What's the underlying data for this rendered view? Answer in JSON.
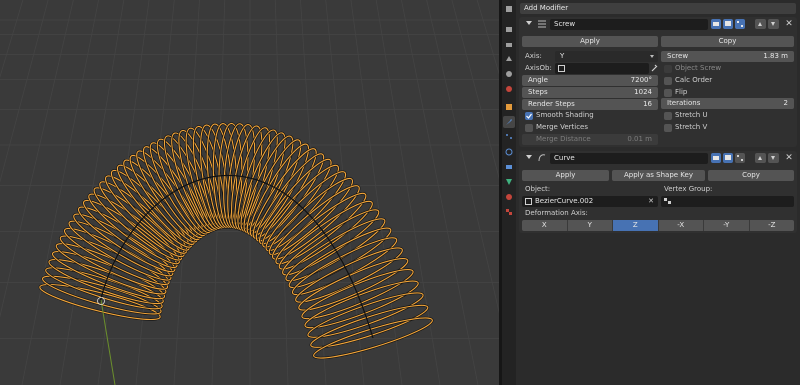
{
  "properties": {
    "add_modifier_label": "Add Modifier"
  },
  "screw": {
    "name": "Screw",
    "apply_label": "Apply",
    "copy_label": "Copy",
    "axis_label": "Axis:",
    "axis_value": "Y",
    "axisob_label": "AxisOb:",
    "angle_label": "Angle",
    "angle_value": "7200°",
    "steps_label": "Steps",
    "steps_value": "1024",
    "render_steps_label": "Render Steps",
    "render_steps_value": "16",
    "smooth_shading_label": "Smooth Shading",
    "smooth_shading_checked": true,
    "merge_vertices_label": "Merge Vertices",
    "merge_vertices_checked": false,
    "merge_distance_label": "Merge Distance",
    "merge_distance_value": "0.01 m",
    "screw_label": "Screw",
    "screw_value": "1.83 m",
    "object_screw_label": "Object Screw",
    "calc_order_label": "Calc Order",
    "flip_label": "Flip",
    "iterations_label": "Iterations",
    "iterations_value": "2",
    "stretch_u_label": "Stretch U",
    "stretch_v_label": "Stretch V"
  },
  "curve": {
    "name": "Curve",
    "apply_label": "Apply",
    "apply_shape_key_label": "Apply as Shape Key",
    "copy_label": "Copy",
    "object_label": "Object:",
    "object_value": "BezierCurve.002",
    "vertex_group_label": "Vertex Group:",
    "deformation_axis_label": "Deformation Axis:",
    "axes": [
      "X",
      "Y",
      "Z",
      "-X",
      "-Y",
      "-Z"
    ],
    "selected_axis": "Z"
  },
  "colors": {
    "accent": "#4772b3",
    "selection_orange": "#f2a53a",
    "panel_bg": "#303030",
    "viewport_bg": "#3a3a3a"
  }
}
